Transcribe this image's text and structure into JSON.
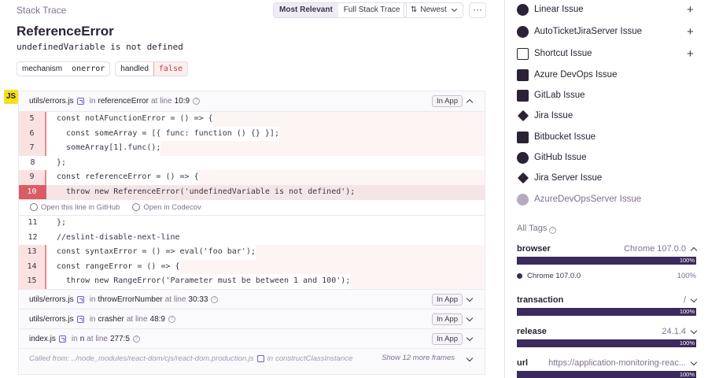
{
  "stack": {
    "section_title": "Stack Trace",
    "view_modes": [
      "Most Relevant",
      "Full Stack Trace"
    ],
    "sort_label": "Newest",
    "more_label": "···",
    "error_type": "ReferenceError",
    "error_message": "undefinedVariable is not defined",
    "chips": [
      {
        "key": "mechanism",
        "value": "onerror",
        "bad": false
      },
      {
        "key": "handled",
        "value": "false",
        "bad": true
      }
    ],
    "platform_badge": "JS",
    "frames": [
      {
        "file": "utils/errors.js",
        "in_text": "in",
        "function": "referenceError",
        "at_line_text": "at line",
        "line": "10:9",
        "in_app": "In App",
        "expanded": true,
        "code_before": [
          {
            "num": "5",
            "code": "const notAFunctionError = () => {"
          },
          {
            "num": "6",
            "code": "  const someArray = [{ func: function () {} }];"
          },
          {
            "num": "7",
            "code": "  someArray[1].func();"
          },
          {
            "num": "8",
            "code": "};"
          },
          {
            "num": "9",
            "code": "const referenceError = () => {"
          },
          {
            "num": "10",
            "code": "  throw new ReferenceError('undefinedVariable is not defined');"
          }
        ],
        "github_link": "Open this line in GitHub",
        "codecov_link": "Open in Codecov",
        "code_after": [
          {
            "num": "11",
            "code": "};"
          },
          {
            "num": "12",
            "code": "//eslint-disable-next-line"
          },
          {
            "num": "13",
            "code": "const syntaxError = () => eval('foo bar');"
          },
          {
            "num": "14",
            "code": "const rangeError = () => {"
          },
          {
            "num": "15",
            "code": "  throw new RangeError('Parameter must be between 1 and 100');"
          }
        ]
      },
      {
        "file": "utils/errors.js",
        "in_text": "in",
        "function": "throwErrorNumber",
        "at_line_text": "at line",
        "line": "30:33",
        "in_app": "In App"
      },
      {
        "file": "utils/errors.js",
        "in_text": "in",
        "function": "crasher",
        "at_line_text": "at line",
        "line": "48:9",
        "in_app": "In App"
      },
      {
        "file": "index.js",
        "in_text": "in",
        "function": "n",
        "at_line_text": "at line",
        "line": "277:5",
        "in_app": "In App"
      }
    ],
    "called_from": {
      "prefix": "Called from: ../node_modules/react-dom/cjs/react-dom.production.js",
      "in_text": "in",
      "function": "constructClassInstance",
      "show_more": "Show 12 more frames"
    }
  },
  "integrations": [
    {
      "label": "Linear Issue",
      "icon": "linear-icon",
      "plus": true
    },
    {
      "label": "AutoTicketJiraServer Issue",
      "icon": "autoticket-icon",
      "plus": true
    },
    {
      "label": "Shortcut Issue",
      "icon": "shortcut-icon",
      "plus": true
    },
    {
      "label": "Azure DevOps Issue",
      "icon": "azure-devops-icon",
      "plus": false
    },
    {
      "label": "GitLab Issue",
      "icon": "gitlab-icon",
      "plus": false
    },
    {
      "label": "Jira Issue",
      "icon": "jira-icon",
      "plus": false
    },
    {
      "label": "Bitbucket Issue",
      "icon": "bitbucket-icon",
      "plus": false
    },
    {
      "label": "GitHub Issue",
      "icon": "github-icon",
      "plus": false
    },
    {
      "label": "Jira Server Issue",
      "icon": "jira-server-icon",
      "plus": false
    },
    {
      "label": "AzureDevOpsServer Issue",
      "icon": "azure-devops-server-icon",
      "plus": false,
      "disabled": true
    }
  ],
  "tags": {
    "title": "All Tags",
    "items": [
      {
        "key": "browser",
        "value": "Chrome 107.0.0",
        "pct": "100%",
        "fill": 1.0,
        "expanded": true,
        "sub_label": "Chrome 107.0.0",
        "sub_pct": "100%"
      },
      {
        "key": "transaction",
        "value": "/",
        "pct": "100%",
        "fill": 1.0
      },
      {
        "key": "release",
        "value": "24.1.4",
        "pct": "100%",
        "fill": 1.0
      },
      {
        "key": "url",
        "value": "https://application-monitoring-reac...",
        "pct": "100%",
        "fill": 1.0
      }
    ]
  },
  "colors": {
    "accent": "#6c5fc7",
    "bar": "#3b2a5c",
    "error_line": "#dc5c63"
  }
}
